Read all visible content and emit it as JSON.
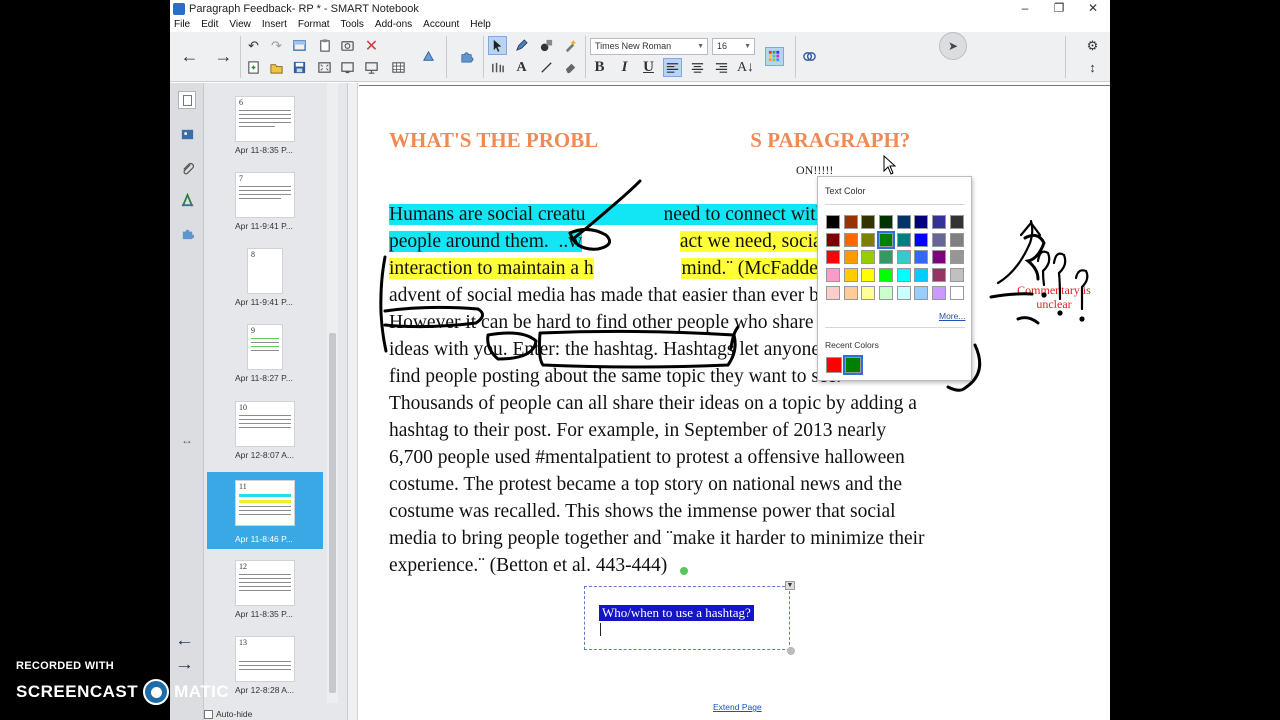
{
  "window": {
    "title": "Paragraph Feedback- RP * - SMART Notebook",
    "controls": [
      "–",
      "❐",
      "✕"
    ]
  },
  "menu": [
    "File",
    "Edit",
    "View",
    "Insert",
    "Format",
    "Tools",
    "Add-ons",
    "Account",
    "Help"
  ],
  "toolbar": {
    "font_name": "Times New Roman",
    "font_size": "16",
    "icons": [
      "back-arrow",
      "forward-arrow",
      "undo",
      "redo",
      "screen-shade",
      "paste",
      "screen-capture",
      "delete",
      "add-page",
      "add-ons",
      "select",
      "pen",
      "shapes",
      "magic-pen",
      "fill",
      "eraser",
      "line",
      "text",
      "bold",
      "italic",
      "underline",
      "align-left",
      "align-center",
      "align-right",
      "text-color",
      "properties",
      "settings",
      "move-toolbar"
    ]
  },
  "sidebar": {
    "thumbnails": [
      {
        "num": "6",
        "label": "Apr 11-8:35 P..."
      },
      {
        "num": "7",
        "label": "Apr 11-9:41 P..."
      },
      {
        "num": "8",
        "label": "Apr 11-9:41 P..."
      },
      {
        "num": "9",
        "label": "Apr 11-8:27 P..."
      },
      {
        "num": "10",
        "label": "Apr 12-8:07 A..."
      },
      {
        "num": "11",
        "label": "Apr 11-8:46 P..."
      },
      {
        "num": "12",
        "label": "Apr 11-8:35 P..."
      },
      {
        "num": "13",
        "label": "Apr 12-8:28 A..."
      }
    ],
    "selected_index": 5,
    "autohide_label": "Auto-hide"
  },
  "page": {
    "headline_left": "WHAT'S THE PROBL",
    "headline_right": "S PARAGRAPH?",
    "subline": "ON!!!!!",
    "lines": [
      {
        "segments": [
          {
            "t": "Humans are social creatu",
            "hl": "cyan"
          },
          {
            "t": "                ",
            "hl": "cyan"
          },
          {
            "t": "need to connect with other ",
            "hl": "cyan"
          }
        ]
      },
      {
        "segments": [
          {
            "t": "people around them.",
            "hl": "cyan"
          },
          {
            "t": "  ..w",
            "hl": "cyan"
          },
          {
            "t": "                    ",
            "hl": ""
          },
          {
            "t": "act we need, social",
            "hl": "yellow"
          }
        ]
      },
      {
        "segments": [
          {
            "t": "interaction to maintain a h",
            "hl": "yellow"
          },
          {
            "t": "                  ",
            "hl": ""
          },
          {
            "t": "mind.¨ (McFadden)",
            "hl": "yellow"
          },
          {
            "t": " The",
            "hl": ""
          }
        ]
      },
      {
        "segments": [
          {
            "t": "advent of social media has made that easier than ever before.",
            "hl": ""
          }
        ]
      },
      {
        "segments": [
          {
            "t": "However it can be hard to find other people who share common",
            "hl": ""
          }
        ]
      },
      {
        "segments": [
          {
            "t": "ideas with you. Enter: the hashtag. Hashtags let anyone immediately",
            "hl": ""
          }
        ]
      },
      {
        "segments": [
          {
            "t": "find people posting about the same topic they want to see.",
            "hl": ""
          }
        ]
      },
      {
        "segments": [
          {
            "t": "Thousands of people can all share their ideas on a topic by adding a",
            "hl": ""
          }
        ]
      },
      {
        "segments": [
          {
            "t": "hashtag to their post. For example, in September of 2013 nearly",
            "hl": ""
          }
        ]
      },
      {
        "segments": [
          {
            "t": "6,700 people used #mentalpatient to protest a offensive halloween",
            "hl": ""
          }
        ]
      },
      {
        "segments": [
          {
            "t": "costume. The protest became a top story on national news and the",
            "hl": ""
          }
        ]
      },
      {
        "segments": [
          {
            "t": "costume was recalled. This shows the immense power that social",
            "hl": ""
          }
        ]
      },
      {
        "segments": [
          {
            "t": "media to bring people together and ¨make it harder to minimize their",
            "hl": ""
          }
        ]
      },
      {
        "segments": [
          {
            "t": "experience.¨ (Betton et al. 443-444)",
            "hl": ""
          }
        ]
      }
    ],
    "comment": "Commentary is unclear",
    "textbox_question": "Who/when to use a hashtag?",
    "extend_page": "Extend Page"
  },
  "color_popup": {
    "title": "Text Color",
    "swatches": [
      "#000000",
      "#993300",
      "#333300",
      "#003300",
      "#003366",
      "#000080",
      "#333399",
      "#333333",
      "#800000",
      "#ff6600",
      "#808000",
      "#008000",
      "#008080",
      "#0000ff",
      "#666699",
      "#808080",
      "#ff0000",
      "#ff9900",
      "#99cc00",
      "#339966",
      "#33cccc",
      "#3366ff",
      "#800080",
      "#969696",
      "#ff99cc",
      "#ffcc00",
      "#ffff00",
      "#00ff00",
      "#00ffff",
      "#00ccff",
      "#993366",
      "#c0c0c0",
      "#ffcccc",
      "#ffcc99",
      "#ffff99",
      "#ccffcc",
      "#ccffff",
      "#99ccff",
      "#cc99ff",
      "#ffffff"
    ],
    "current_index": 11,
    "more_label": "More...",
    "recent_title": "Recent Colors",
    "recent": [
      "#ff0000",
      "#008000"
    ]
  },
  "watermark": {
    "line1": "RECORDED WITH",
    "line2a": "SCREENCAST",
    "line2b": "MATIC"
  }
}
